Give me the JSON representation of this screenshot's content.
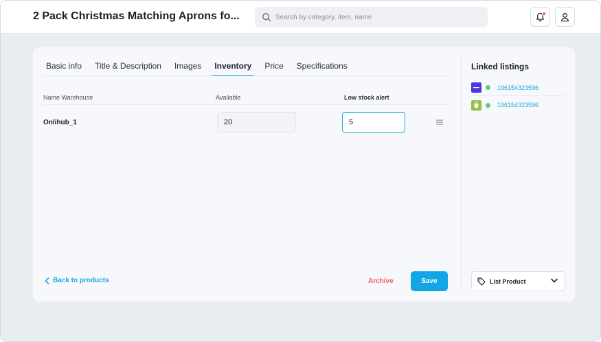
{
  "header": {
    "title": "2 Pack Christmas Matching Aprons fo...",
    "search_placeholder": "Search by category, item, name",
    "icons": [
      "bell-icon",
      "user-icon"
    ],
    "notification_color": "#f2545b"
  },
  "tabs": [
    {
      "label": "Basic info",
      "active": false
    },
    {
      "label": "Title & Description",
      "active": false
    },
    {
      "label": "Images",
      "active": false
    },
    {
      "label": "Inventory",
      "active": true
    },
    {
      "label": "Price",
      "active": false
    },
    {
      "label": "Specifications",
      "active": false
    }
  ],
  "inventory": {
    "columns": [
      "Name Warehouse",
      "Available",
      "Low stock alert"
    ],
    "rows": [
      {
        "warehouse": "Onlihub_1",
        "available": "20",
        "low_stock_alert": "5"
      }
    ]
  },
  "footer": {
    "back_label": "Back to products",
    "archive_label": "Archive",
    "save_label": "Save"
  },
  "linked": {
    "title": "Linked listings",
    "items": [
      {
        "marketplace_icon": "ebay-icon",
        "status": "active",
        "id": "196154323596"
      },
      {
        "marketplace_icon": "shopify-icon",
        "status": "active",
        "id": "196154323596"
      }
    ],
    "list_product_label": "List Product"
  },
  "colors": {
    "accent": "#1aa9e0",
    "save_button": "#12a6e6",
    "archive": "#ef5b5b",
    "status_active": "#5ccb82"
  }
}
